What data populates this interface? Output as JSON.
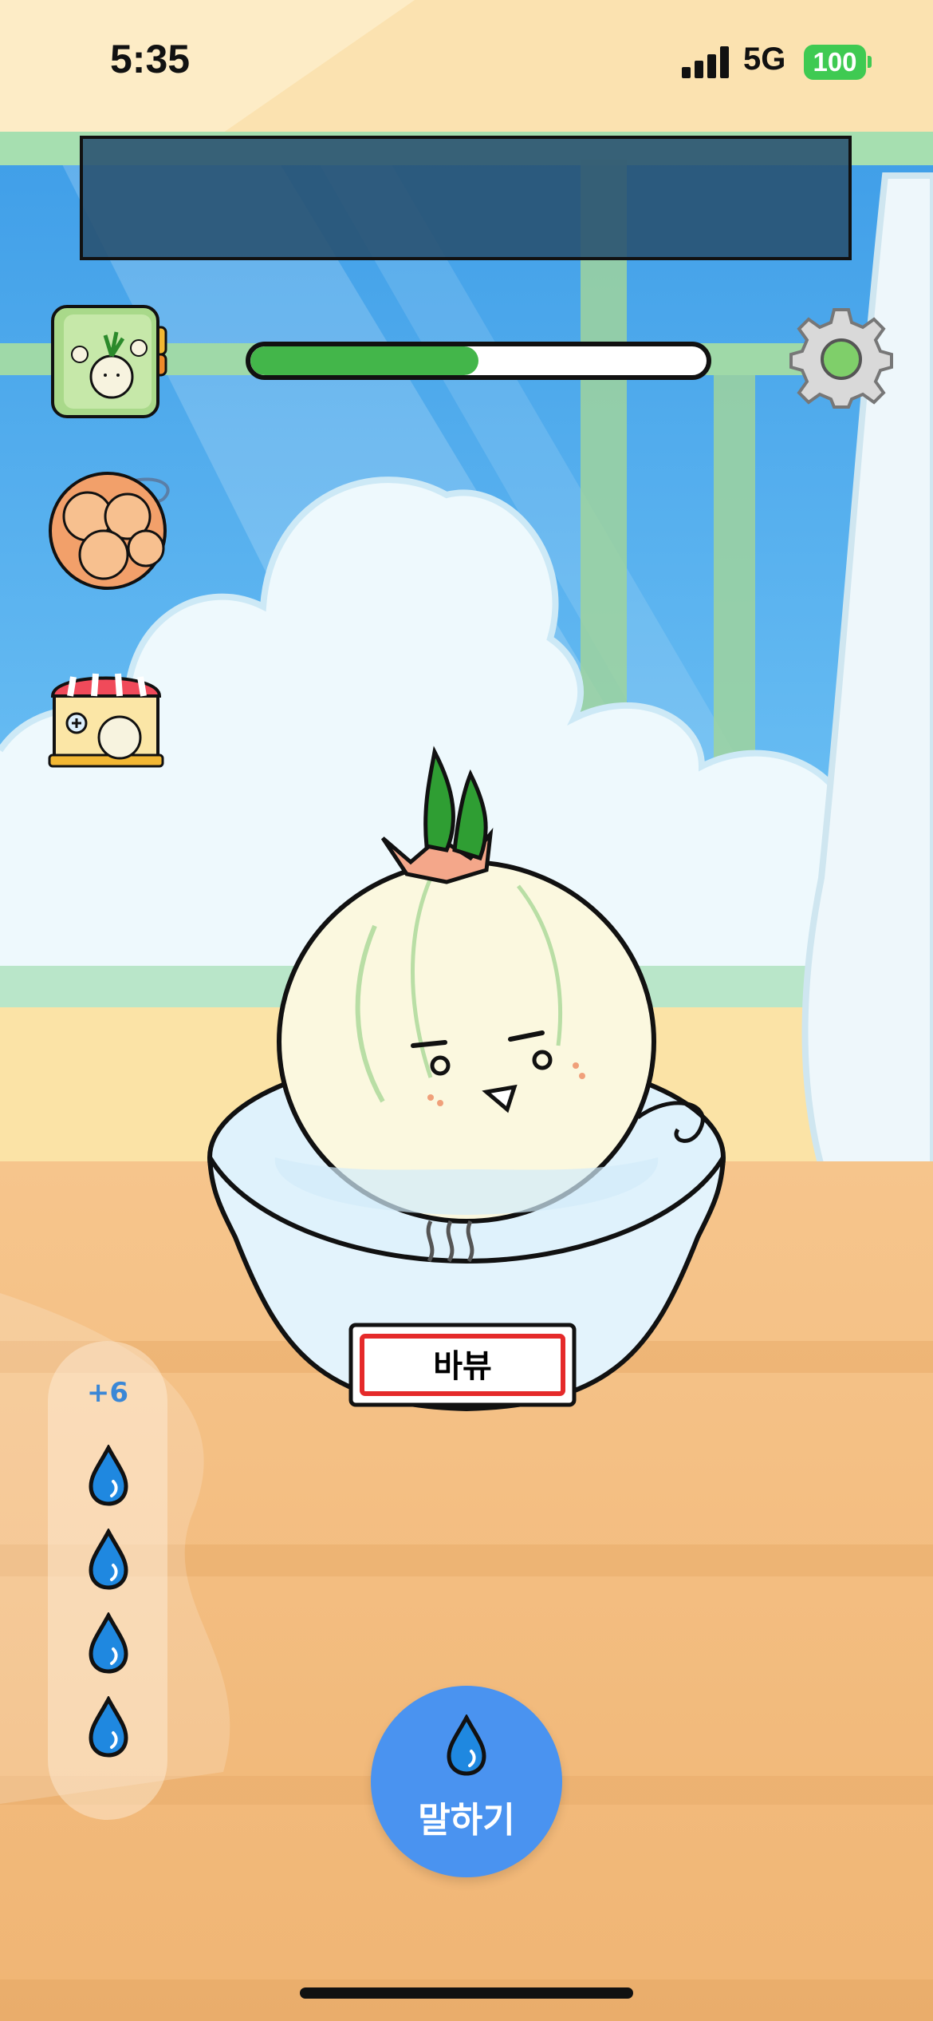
{
  "status_bar": {
    "time": "5:35",
    "network": "5G",
    "battery": "100"
  },
  "game": {
    "growth_progress": 0.5,
    "pot_label": "바뷰",
    "water": {
      "count_text": "+6",
      "drops_visible": 4
    },
    "talk_button": {
      "label": "말하기",
      "icon": "water-drop-icon"
    },
    "side_menu": [
      {
        "name": "onion-collection-book",
        "icon": "onion-book-icon"
      },
      {
        "name": "onion-bag",
        "icon": "onion-bag-icon"
      },
      {
        "name": "onion-shop",
        "icon": "shop-icon"
      }
    ],
    "settings_icon": "gear-icon"
  },
  "colors": {
    "progress_fill": "#43b64a",
    "talk_button": "#4a93f0",
    "sky": "#5ab0f0",
    "floor": "#f2b97b",
    "battery": "#3fca52"
  }
}
